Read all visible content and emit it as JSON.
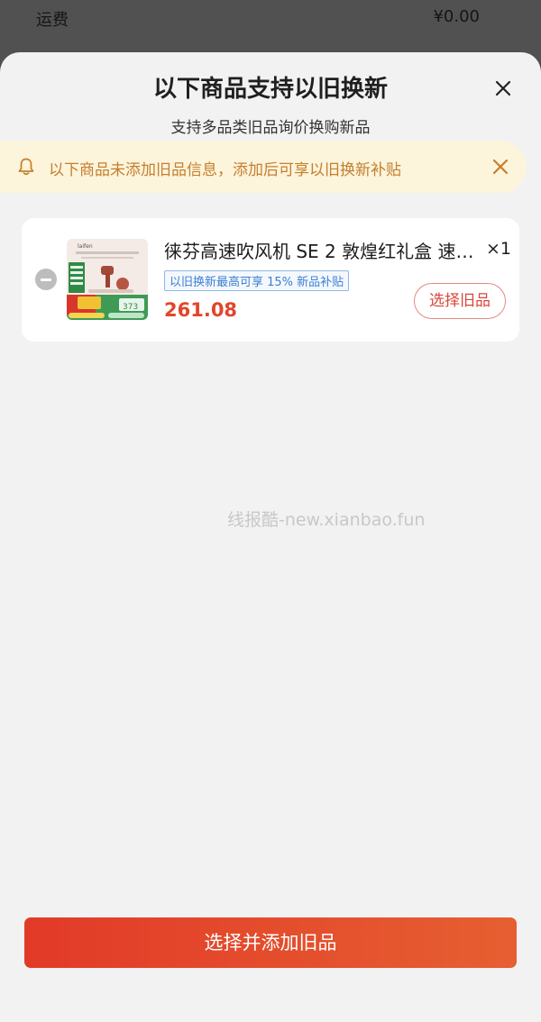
{
  "background": {
    "label": "运费",
    "amount": "¥0.00"
  },
  "sheet": {
    "title": "以下商品支持以旧换新",
    "subtitle": "支持多品类旧品询价换购新品"
  },
  "notice": {
    "text": "以下商品未添加旧品信息，添加后可享以旧换新补贴"
  },
  "product": {
    "title": "徕芬高速吹风机 SE 2 敦煌红礼盒 速…",
    "quantity": "×1",
    "tag": "以旧换新最高可享 15% 新品补贴",
    "price": "261.08",
    "select_button": "选择旧品",
    "thumb_brand": "laifen",
    "thumb_badge": "373"
  },
  "watermark": "线报酷-new.xianbao.fun",
  "footer": {
    "primary_button": "选择并添加旧品"
  },
  "colors": {
    "accent": "#e2452b",
    "notice_bg": "#fcf4db",
    "notice_text": "#c57f2e",
    "tag_blue": "#3b7fd2"
  }
}
